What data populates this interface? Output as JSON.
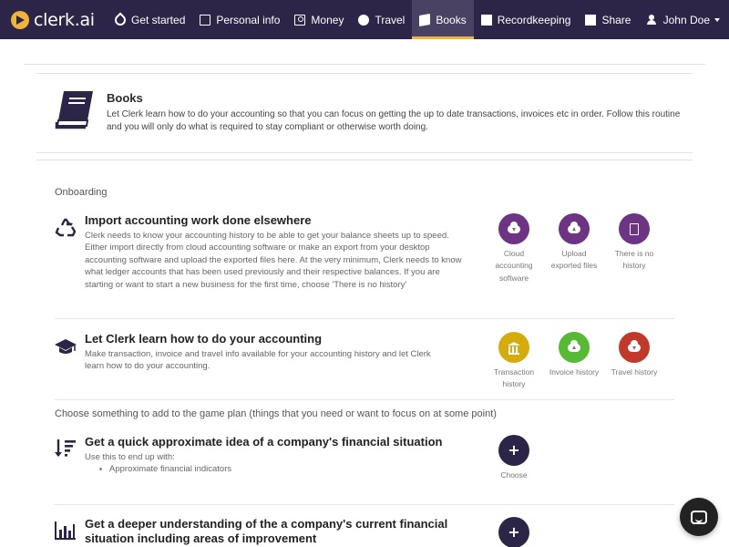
{
  "brand": {
    "name": "clerk.ai"
  },
  "nav": {
    "items": [
      {
        "label": "Get started",
        "icon": "rocket-icon"
      },
      {
        "label": "Personal info",
        "icon": "id-card-icon"
      },
      {
        "label": "Money",
        "icon": "money-icon"
      },
      {
        "label": "Travel",
        "icon": "globe-icon"
      },
      {
        "label": "Books",
        "icon": "book-icon",
        "active": true
      },
      {
        "label": "Recordkeeping",
        "icon": "table-icon"
      },
      {
        "label": "Share",
        "icon": "share-icon"
      }
    ],
    "user": {
      "label": "John Doe",
      "icon": "user-icon"
    }
  },
  "header": {
    "title": "Books",
    "description": "Let Clerk learn how to do your accounting so that you can focus on getting the up to date transactions, invoices etc in order. Follow this routine and you will only do what is required to stay compliant or otherwise worth doing."
  },
  "onboarding": {
    "label": "Onboarding",
    "items": [
      {
        "title": "Import accounting work done elsewhere",
        "icon": "recycle-icon",
        "description": "Clerk needs to know your accounting history to be able to get your balance sheets up to speed. Either import directly from cloud accounting software or make an export from your desktop accounting software and upload the exported files here. At the very minimum, Clerk needs to know what ledger accounts that has been used previously and their respective balances. If you are starting or want to start a new business for the first time, choose 'There is no history'",
        "actions": [
          {
            "label": "Cloud accounting software",
            "icon": "cloud-download-icon",
            "color": "#6c3483"
          },
          {
            "label": "Upload exported files",
            "icon": "cloud-upload-icon",
            "color": "#6c3483"
          },
          {
            "label": "There is no history",
            "icon": "file-icon",
            "color": "#6c3483"
          }
        ]
      },
      {
        "title": "Let Clerk learn how to do your accounting",
        "icon": "graduation-cap-icon",
        "description": "Make transaction, invoice and travel info available for your accounting history and let Clerk learn how to do your accounting.",
        "actions": [
          {
            "label": "Transaction history",
            "icon": "bank-icon",
            "color": "#d4ac0d"
          },
          {
            "label": "Invoice history",
            "icon": "cloud-upload-icon",
            "color": "#58b935"
          },
          {
            "label": "Travel history",
            "icon": "cloud-download-icon",
            "color": "#c0392b"
          }
        ]
      }
    ]
  },
  "game_plan": {
    "label": "Choose something to add to the game plan (things that you need or want to focus on at some point)",
    "items": [
      {
        "title": "Get a quick approximate idea of a company's financial situation",
        "icon": "sort-amount-icon",
        "subtitle": "Use this to end up with:",
        "bullets": [
          "Approximate financial indicators"
        ],
        "action": {
          "label": "Choose",
          "icon": "plus-icon",
          "color": "#2d2547"
        }
      },
      {
        "title": "Get a deeper understanding of the a company's current financial situation including areas of improvement",
        "icon": "bar-chart-icon",
        "action": {
          "label": "Choose",
          "icon": "plus-icon",
          "color": "#2d2547"
        }
      }
    ]
  },
  "chat": {
    "icon": "chat-icon"
  }
}
